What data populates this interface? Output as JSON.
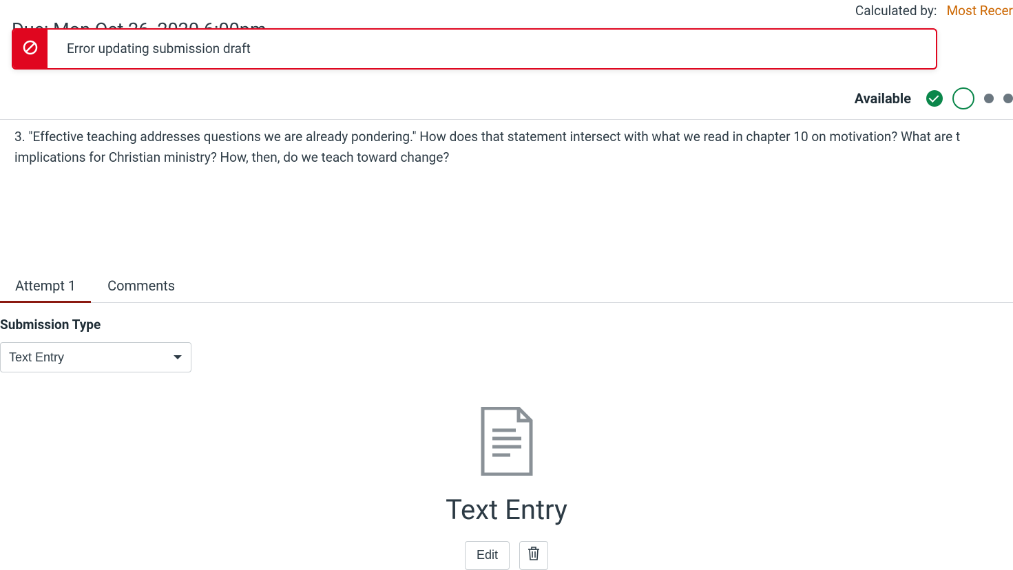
{
  "meta": {
    "calculated_label": "Calculated by:",
    "calculated_link": "Most Recer",
    "due": "Due: Mon Oct 26, 2020 6:00pm"
  },
  "alert": {
    "message": "Error updating submission draft"
  },
  "status": {
    "label": "Available"
  },
  "question": {
    "text": "3. \"Effective teaching addresses questions we are already pondering.\" How does that statement intersect with what we read in chapter 10 on motivation? What are t implications for Christian ministry? How, then, do we teach toward change?"
  },
  "tabs": {
    "attempt": "Attempt 1",
    "comments": "Comments"
  },
  "submission": {
    "label": "Submission Type",
    "selected": "Text Entry"
  },
  "entry": {
    "title": "Text Entry",
    "edit": "Edit"
  }
}
